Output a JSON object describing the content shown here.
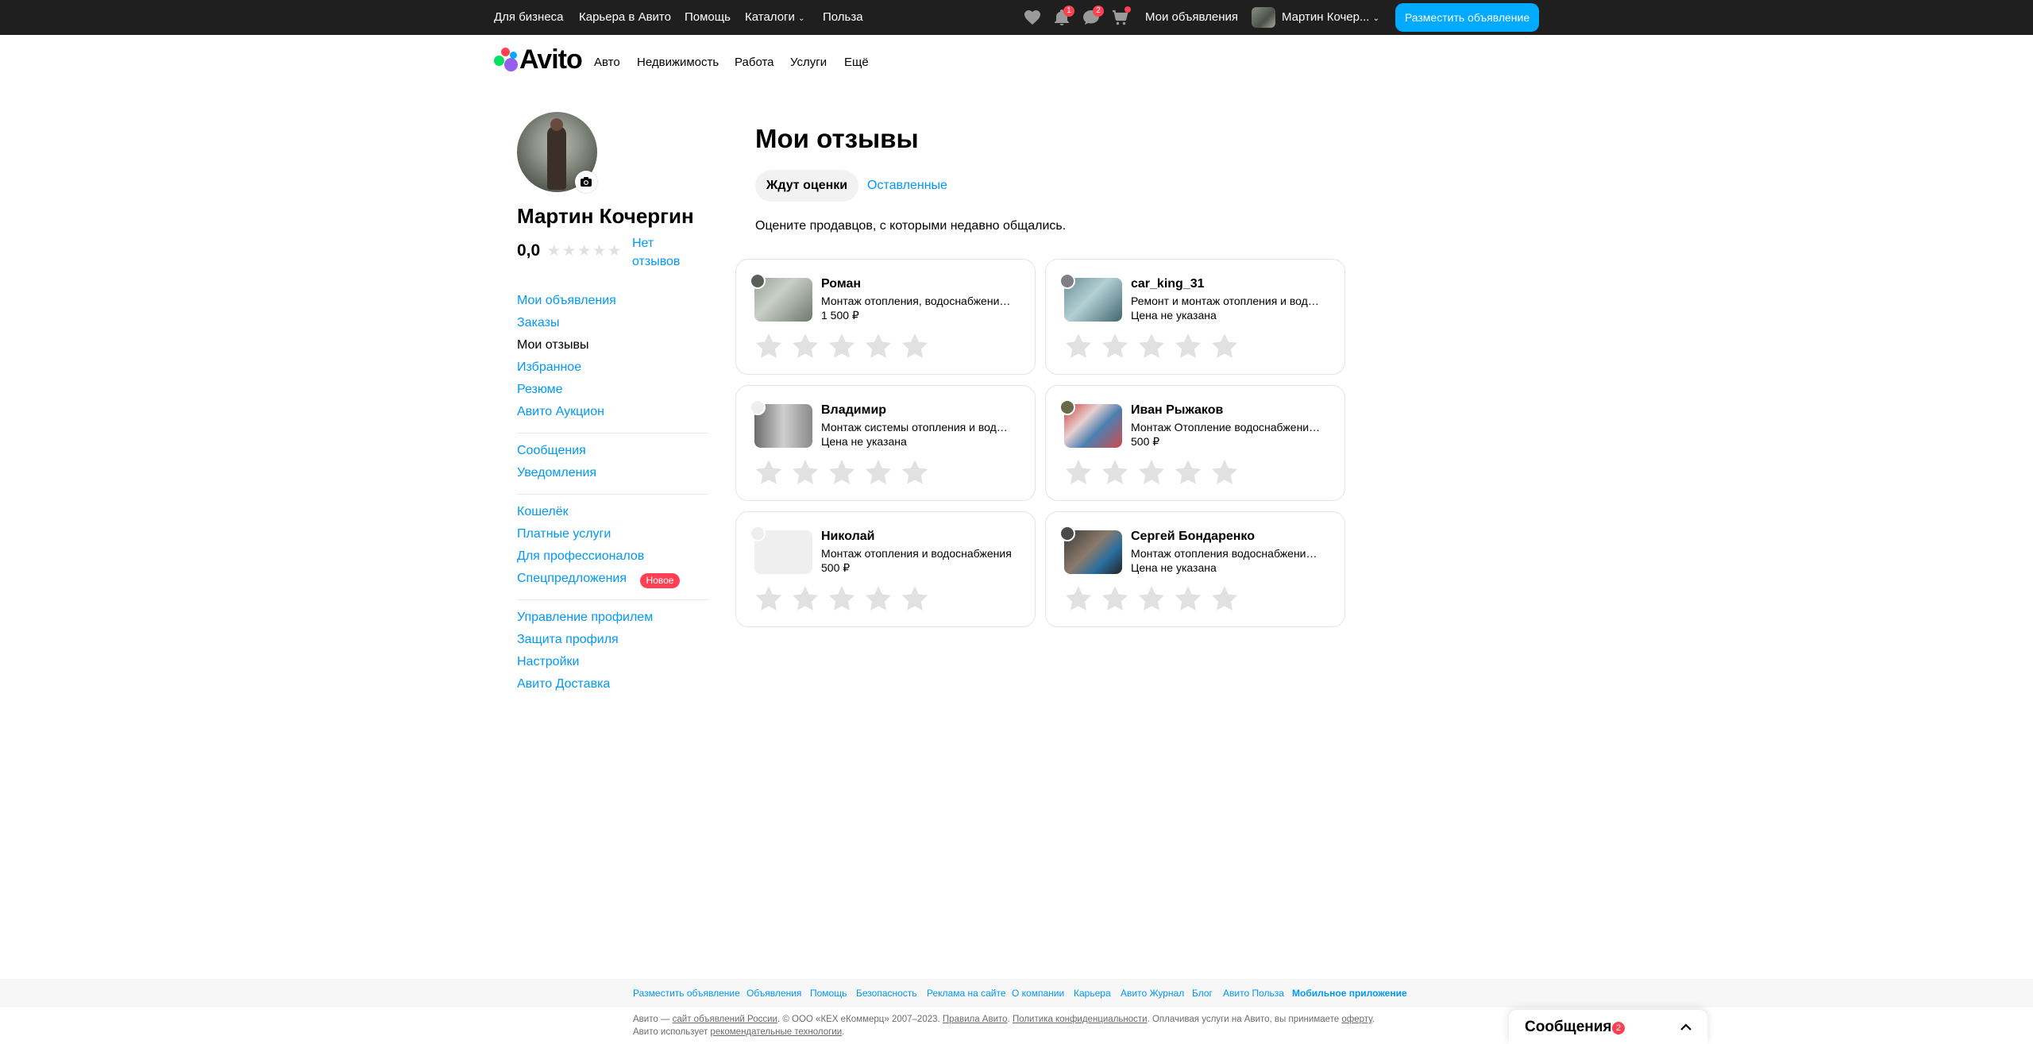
{
  "topbar": {
    "links": [
      "Для бизнеса",
      "Карьера в Авито",
      "Помощь",
      "Каталоги",
      "Польза"
    ],
    "notifications_count": "1",
    "messages_count": "2",
    "my_ads": "Мои объявления",
    "user_name": "Мартин Кочер...",
    "post_ad": "Разместить объявление"
  },
  "header": {
    "logo": "Avito",
    "nav": [
      "Авто",
      "Недвижимость",
      "Работа",
      "Услуги",
      "Ещё"
    ]
  },
  "profile": {
    "name": "Мартин Кочергин",
    "rating": "0,0",
    "stars_filled": 0,
    "no_reviews": "Нет отзывов"
  },
  "sidebar": {
    "group1": [
      "Мои объявления",
      "Заказы",
      "Мои отзывы",
      "Избранное",
      "Резюме",
      "Авито Аукцион"
    ],
    "group2": [
      "Сообщения",
      "Уведомления"
    ],
    "group3": [
      "Кошелёк",
      "Платные услуги",
      "Для профессионалов",
      "Спецпредложения"
    ],
    "new_badge": "Новое",
    "group4": [
      "Управление профилем",
      "Защита профиля",
      "Настройки",
      "Авито Доставка"
    ]
  },
  "main": {
    "title": "Мои отзывы",
    "tabs": [
      "Ждут оценки",
      "Оставленные"
    ],
    "subtitle": "Оцените продавцов, с которыми недавно общались.",
    "cards": [
      {
        "seller": "Роман",
        "desc": "Монтаж отопления, водоснабжения и канализации",
        "price": "1 500 ₽"
      },
      {
        "seller": "car_king_31",
        "desc": "Ремонт и монтаж отопления и водоснабжения",
        "price": "Цена не указана"
      },
      {
        "seller": "Владимир",
        "desc": "Монтаж системы отопления и водоснабжения",
        "price": "Цена не указана"
      },
      {
        "seller": "Иван Рыжаков",
        "desc": "Монтаж Отопление водоснабжение канализация",
        "price": "500 ₽"
      },
      {
        "seller": "Николай",
        "desc": "Монтаж отопления и водоснабжения",
        "price": "500 ₽"
      },
      {
        "seller": "Сергей Бондаренко",
        "desc": "Монтаж отопления водоснабжения канализации",
        "price": "Цена не указана"
      }
    ]
  },
  "footer": {
    "links": [
      "Разместить объявление",
      "Объявления",
      "Помощь",
      "Безопасность",
      "Реклама на сайте",
      "О компании",
      "Карьера",
      "Авито Журнал",
      "Блог",
      "Авито Польза",
      "Мобильное приложение"
    ],
    "legal_1": "Авито — ",
    "legal_link_1": "сайт объявлений России",
    "legal_2": ". © ООО «КЕХ еКоммерц» 2007–2023. ",
    "legal_link_2": "Правила Авито",
    "legal_3": ". ",
    "legal_link_3": "Политика конфиденциальности",
    "legal_4": ". Оплачивая услуги на Авито, вы принимаете ",
    "legal_link_4": "оферту",
    "legal_5": ". Авито использует ",
    "legal_link_5": "рекомендательные технологии",
    "legal_6": "."
  },
  "messenger": {
    "title": "Сообщения",
    "count": "2"
  },
  "colors": {
    "accent": "#0099f7",
    "badge": "#ff4053",
    "topbar": "#1f1f1f",
    "post_button": "#00aaff"
  }
}
